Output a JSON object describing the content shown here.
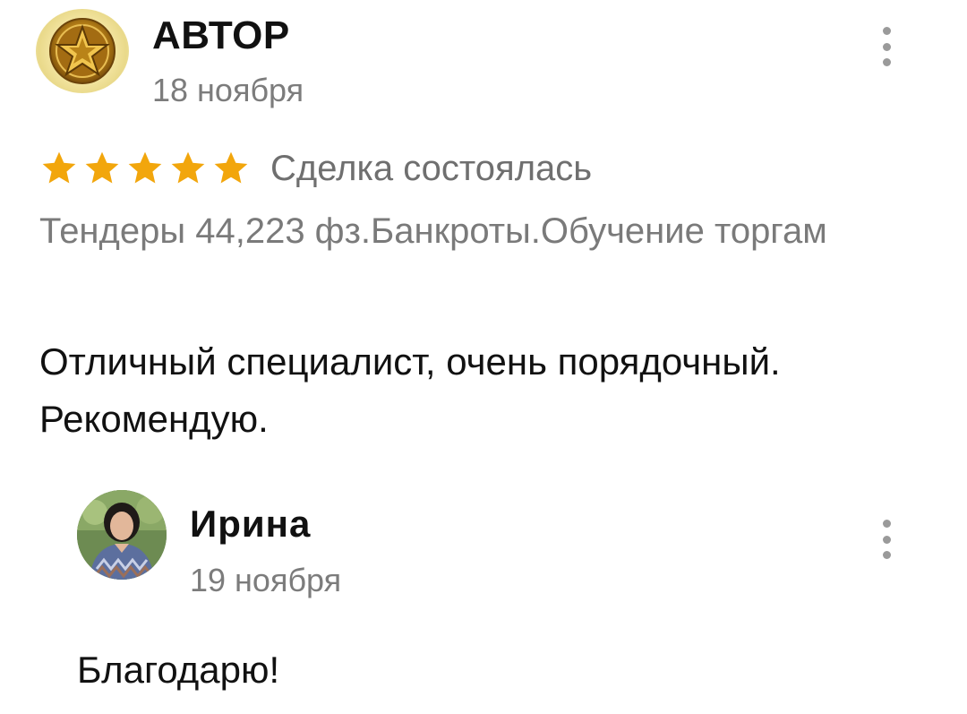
{
  "review": {
    "author_name": "АВТОР",
    "date": "18 ноября",
    "rating": 5,
    "rating_max": 5,
    "rating_label": "Сделка состоялась",
    "service": "Тендеры 44,223 фз.Банкроты.Обучение торгам",
    "text": "Отличный специалист, очень порядочный. Рекомендую.",
    "star_color": "#F2A60C"
  },
  "reply": {
    "author_name": "Ирина",
    "date": "19 ноября",
    "text": "Благодарю!"
  },
  "icons": {
    "menu": "more-vertical-icon",
    "star": "star-icon"
  }
}
